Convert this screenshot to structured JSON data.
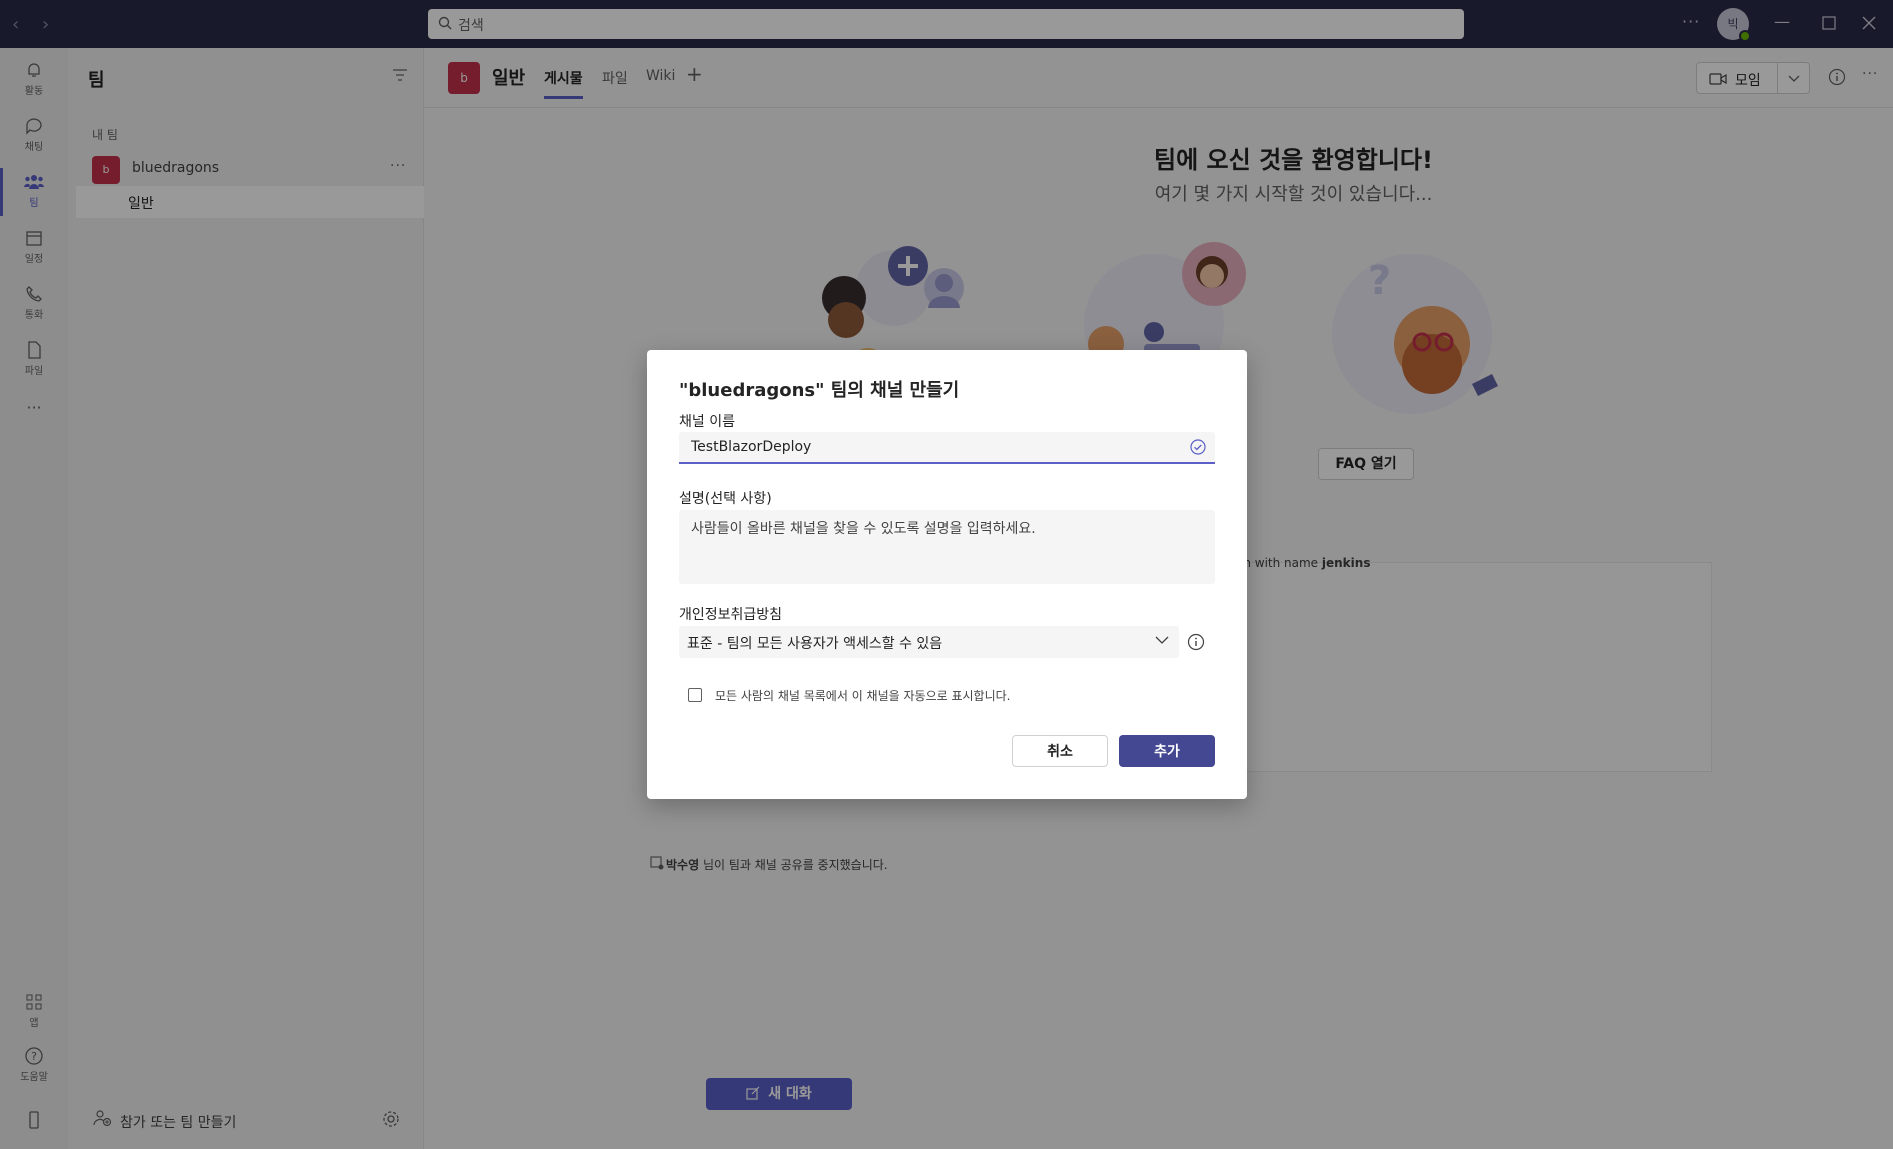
{
  "titlebar": {
    "search_placeholder": "검색",
    "avatar_initial": "빅",
    "more": "···"
  },
  "rail": {
    "items": [
      {
        "label": "활동",
        "icon": "bell-icon"
      },
      {
        "label": "채팅",
        "icon": "chat-icon"
      },
      {
        "label": "팀",
        "icon": "teams-icon"
      },
      {
        "label": "일정",
        "icon": "calendar-icon"
      },
      {
        "label": "통화",
        "icon": "phone-icon"
      },
      {
        "label": "파일",
        "icon": "file-icon"
      },
      {
        "label": "앱",
        "icon": "apps-icon"
      },
      {
        "label": "도움말",
        "icon": "help-icon"
      }
    ],
    "more": "···"
  },
  "teams_panel": {
    "title": "팀",
    "section": "내 팀",
    "team": {
      "avatar": "b",
      "name": "bluedragons",
      "more": "···"
    },
    "channel": "일반",
    "join_create": "참가 또는 팀 만들기"
  },
  "channel_header": {
    "avatar": "b",
    "name": "일반",
    "tabs": [
      "게시물",
      "파일",
      "Wiki"
    ],
    "add_tab": "+",
    "meet_label": "모임",
    "more": "···"
  },
  "welcome": {
    "title": "팀에 오신 것을 환영합니다!",
    "subtitle": "여기 몇 가지 시작할 것이 있습니다...",
    "faq_button": "FAQ 열기"
  },
  "feed": {
    "text_prefix": "on with name ",
    "text_bold": "jenkins",
    "notice_name": "박수영",
    "notice_text": " 님이 팀과 채널 공유를 중지했습니다.",
    "new_conversation": "새 대화"
  },
  "dialog": {
    "title": "\"bluedragons\" 팀의 채널 만들기",
    "name_label": "채널 이름",
    "name_value": "TestBlazorDeploy",
    "desc_label": "설명(선택 사항)",
    "desc_placeholder": "사람들이 올바른 채널을 찾을 수 있도록 설명을 입력하세요.",
    "privacy_label": "개인정보취급방침",
    "privacy_value": "표준 - 팀의 모든 사용자가 액세스할 수 있음",
    "show_checkbox_label": "모든 사람의 채널 목록에서 이 채널을 자동으로 표시합니다.",
    "show_checked": false,
    "cancel": "취소",
    "add": "추가"
  },
  "colors": {
    "accent": "#5b5fc7",
    "primary_button": "#444791",
    "titlebar": "#2b2b4a",
    "team_avatar": "#c4314b"
  }
}
